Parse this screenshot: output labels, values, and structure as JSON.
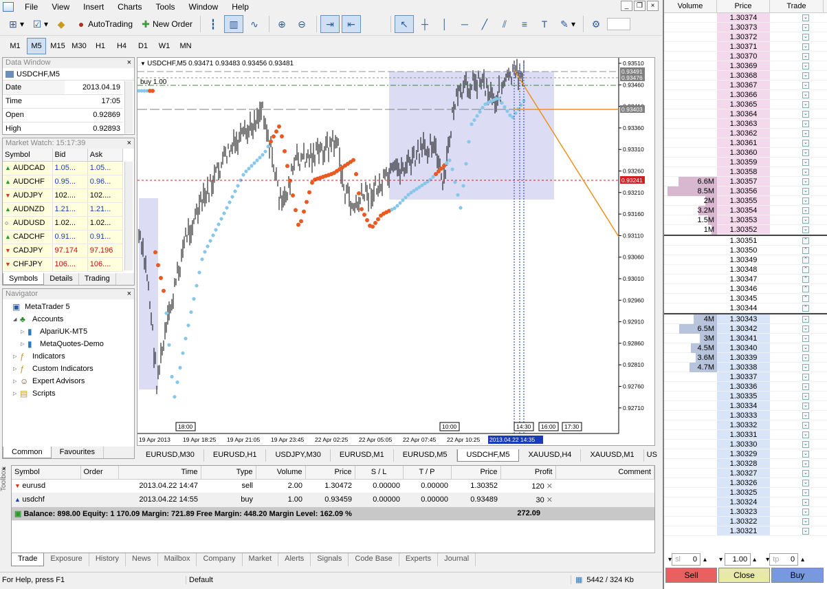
{
  "menu": [
    "File",
    "View",
    "Insert",
    "Charts",
    "Tools",
    "Window",
    "Help"
  ],
  "toolbar": {
    "autotrading": "AutoTrading",
    "new_order": "New Order"
  },
  "timeframes": [
    "M1",
    "M5",
    "M15",
    "M30",
    "H1",
    "H4",
    "D1",
    "W1",
    "MN"
  ],
  "timeframe_active": "M5",
  "data_window": {
    "title": "Data Window",
    "symbol": "USDCHF,M5",
    "rows": [
      {
        "k": "Date",
        "v": "2013.04.19"
      },
      {
        "k": "Time",
        "v": "17:05"
      },
      {
        "k": "Open",
        "v": "0.92869"
      },
      {
        "k": "High",
        "v": "0.92893"
      }
    ]
  },
  "market_watch": {
    "title": "Market Watch: 15:17:39",
    "headers": [
      "Symbol",
      "Bid",
      "Ask"
    ],
    "rows": [
      {
        "s": "AUDCAD",
        "b": "1.05...",
        "a": "1.05...",
        "d": "up",
        "c": "blue"
      },
      {
        "s": "AUDCHF",
        "b": "0.95...",
        "a": "0.96...",
        "d": "up",
        "c": "blue"
      },
      {
        "s": "AUDJPY",
        "b": "102....",
        "a": "102....",
        "d": "dn",
        "c": "black"
      },
      {
        "s": "AUDNZD",
        "b": "1.21...",
        "a": "1.21...",
        "d": "up",
        "c": "blue"
      },
      {
        "s": "AUDUSD",
        "b": "1.02...",
        "a": "1.02...",
        "d": "nt",
        "c": "black"
      },
      {
        "s": "CADCHF",
        "b": "0.91...",
        "a": "0.91...",
        "d": "up",
        "c": "blue"
      },
      {
        "s": "CADJPY",
        "b": "97.174",
        "a": "97.196",
        "d": "dn",
        "c": "red"
      },
      {
        "s": "CHFJPY",
        "b": "106....",
        "a": "106....",
        "d": "dn",
        "c": "red"
      }
    ],
    "tabs": [
      "Symbols",
      "Details",
      "Trading"
    ]
  },
  "navigator": {
    "title": "Navigator",
    "items": [
      {
        "t": "MetaTrader 5",
        "lvl": 0
      },
      {
        "t": "Accounts",
        "lvl": 1
      },
      {
        "t": "AlpariUK-MT5",
        "lvl": 2
      },
      {
        "t": "MetaQuotes-Demo",
        "lvl": 2
      },
      {
        "t": "Indicators",
        "lvl": 1
      },
      {
        "t": "Custom Indicators",
        "lvl": 1
      },
      {
        "t": "Expert Advisors",
        "lvl": 1
      },
      {
        "t": "Scripts",
        "lvl": 1
      }
    ],
    "tabs": [
      "Common",
      "Favourites"
    ]
  },
  "chart": {
    "header": "USDCHF,M5  0.93471 0.93483 0.93456 0.93481",
    "position_label": "buy 1.00",
    "yticks": [
      "0.93510",
      "0.93460",
      "0.93410",
      "0.93360",
      "0.93310",
      "0.93260",
      "0.93210",
      "0.93160",
      "0.93110",
      "0.93060",
      "0.93010",
      "0.92960",
      "0.92910",
      "0.92860",
      "0.92810",
      "0.92760",
      "0.92710"
    ],
    "price_tags": [
      "0.93491",
      "0.93476",
      "0.93403",
      "0.93241"
    ],
    "xticks": [
      "19 Apr 2013",
      "19 Apr 18:25",
      "19 Apr 21:05",
      "19 Apr 23:45",
      "22 Apr 02:25",
      "22 Apr 05:05",
      "22 Apr 07:45",
      "22 Apr 10:25"
    ],
    "x_current": "2013.04.22 14:35",
    "time_marks": [
      "18:00",
      "10:00",
      "14:30",
      "16:00",
      "17:30"
    ]
  },
  "chart_tabs": [
    "EURUSD,M30",
    "EURUSD,H1",
    "USDJPY,M30",
    "EURUSD,M1",
    "EURUSD,M5",
    "USDCHF,M5",
    "XAUUSD,H4",
    "XAUUSD,M1",
    "US"
  ],
  "chart_tab_active": "USDCHF,M5",
  "trade": {
    "headers": [
      "Symbol",
      "Order",
      "Time",
      "Type",
      "Volume",
      "Price",
      "S / L",
      "T / P",
      "Price",
      "Profit",
      "Comment"
    ],
    "rows": [
      {
        "sym": "eurusd",
        "time": "2013.04.22 14:47",
        "type": "sell",
        "vol": "2.00",
        "price": "1.30472",
        "sl": "0.00000",
        "tp": "0.00000",
        "cur": "1.30352",
        "profit": "120"
      },
      {
        "sym": "usdchf",
        "time": "2013.04.22 14:55",
        "type": "buy",
        "vol": "1.00",
        "price": "0.93459",
        "sl": "0.00000",
        "tp": "0.00000",
        "cur": "0.93489",
        "profit": "30"
      }
    ],
    "balance": "Balance: 898.00  Equity: 1 170.09  Margin: 721.89  Free Margin: 448.20  Margin Level: 162.09 %",
    "total": "272.09"
  },
  "bottom_tabs": [
    "Trade",
    "Exposure",
    "History",
    "News",
    "Mailbox",
    "Company",
    "Market",
    "Alerts",
    "Signals",
    "Code Base",
    "Experts",
    "Journal"
  ],
  "toolbox_label": "Toolbox",
  "status": {
    "help": "For Help, press F1",
    "profile": "Default",
    "traffic": "5442 / 324 Kb"
  },
  "dom": {
    "headers": [
      "Volume",
      "Price",
      "Trade"
    ],
    "asks": [
      [
        "",
        "1.30374"
      ],
      [
        "",
        "1.30373"
      ],
      [
        "",
        "1.30372"
      ],
      [
        "",
        "1.30371"
      ],
      [
        "",
        "1.30370"
      ],
      [
        "",
        "1.30369"
      ],
      [
        "",
        "1.30368"
      ],
      [
        "",
        "1.30367"
      ],
      [
        "",
        "1.30366"
      ],
      [
        "",
        "1.30365"
      ],
      [
        "",
        "1.30364"
      ],
      [
        "",
        "1.30363"
      ],
      [
        "",
        "1.30362"
      ],
      [
        "",
        "1.30361"
      ],
      [
        "",
        "1.30360"
      ],
      [
        "",
        "1.30359"
      ],
      [
        "",
        "1.30358"
      ],
      [
        "6.6M",
        "1.30357"
      ],
      [
        "8.5M",
        "1.30356"
      ],
      [
        "2M",
        "1.30355"
      ],
      [
        "3.2M",
        "1.30354"
      ],
      [
        "1.5M",
        "1.30353"
      ],
      [
        "1M",
        "1.30352"
      ]
    ],
    "mid": [
      "1.30351",
      "1.30350",
      "1.30349",
      "1.30348",
      "1.30347",
      "1.30346",
      "1.30345",
      "1.30344"
    ],
    "bids": [
      [
        "4M",
        "1.30343"
      ],
      [
        "6.5M",
        "1.30342"
      ],
      [
        "3M",
        "1.30341"
      ],
      [
        "4.5M",
        "1.30340"
      ],
      [
        "3.6M",
        "1.30339"
      ],
      [
        "4.7M",
        "1.30338"
      ],
      [
        "",
        "1.30337"
      ],
      [
        "",
        "1.30336"
      ],
      [
        "",
        "1.30335"
      ],
      [
        "",
        "1.30334"
      ],
      [
        "",
        "1.30333"
      ],
      [
        "",
        "1.30332"
      ],
      [
        "",
        "1.30331"
      ],
      [
        "",
        "1.30330"
      ],
      [
        "",
        "1.30329"
      ],
      [
        "",
        "1.30328"
      ],
      [
        "",
        "1.30327"
      ],
      [
        "",
        "1.30326"
      ],
      [
        "",
        "1.30325"
      ],
      [
        "",
        "1.30324"
      ],
      [
        "",
        "1.30323"
      ],
      [
        "",
        "1.30322"
      ],
      [
        "",
        "1.30321"
      ]
    ],
    "sl_label": "sl",
    "sl_value": "0",
    "volume": "1.00",
    "tp_label": "tp",
    "tp_value": "0",
    "sell": "Sell",
    "close": "Close",
    "buy": "Buy"
  },
  "colors": {
    "ask_bg": "#f4d8ec",
    "bid_bg": "#d8e4f8",
    "ask_bar": "#d8b8d0",
    "bid_bar": "#b8c4dc",
    "sell": "#e86060",
    "close": "#e8e8a8",
    "buy": "#7898e0"
  }
}
